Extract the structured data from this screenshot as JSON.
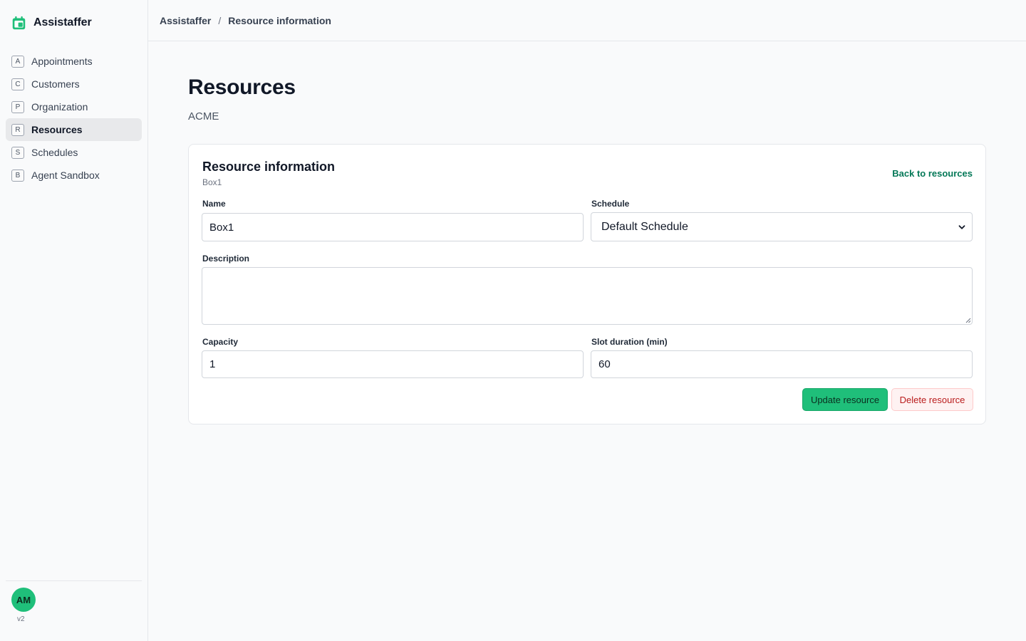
{
  "app": {
    "name": "Assistaffer",
    "version": "v2",
    "user_initials": "AM"
  },
  "colors": {
    "accent": "#1fbf7a",
    "link": "#047857",
    "danger": "#b91c1c"
  },
  "sidebar": {
    "items": [
      {
        "key": "A",
        "label": "Appointments",
        "active": false
      },
      {
        "key": "C",
        "label": "Customers",
        "active": false
      },
      {
        "key": "P",
        "label": "Organization",
        "active": false
      },
      {
        "key": "R",
        "label": "Resources",
        "active": true
      },
      {
        "key": "S",
        "label": "Schedules",
        "active": false
      },
      {
        "key": "B",
        "label": "Agent Sandbox",
        "active": false
      }
    ]
  },
  "breadcrumb": {
    "root": "Assistaffer",
    "separator": "/",
    "current": "Resource information"
  },
  "page": {
    "title": "Resources",
    "subtitle": "ACME"
  },
  "card": {
    "title": "Resource information",
    "subtitle": "Box1",
    "back_link": "Back to resources",
    "fields": {
      "name": {
        "label": "Name",
        "value": "Box1"
      },
      "schedule": {
        "label": "Schedule",
        "value": "Default Schedule"
      },
      "description": {
        "label": "Description",
        "value": ""
      },
      "capacity": {
        "label": "Capacity",
        "value": "1"
      },
      "slot_duration": {
        "label": "Slot duration (min)",
        "value": "60"
      }
    },
    "update_button": "Update resource",
    "delete_button": "Delete resource"
  }
}
